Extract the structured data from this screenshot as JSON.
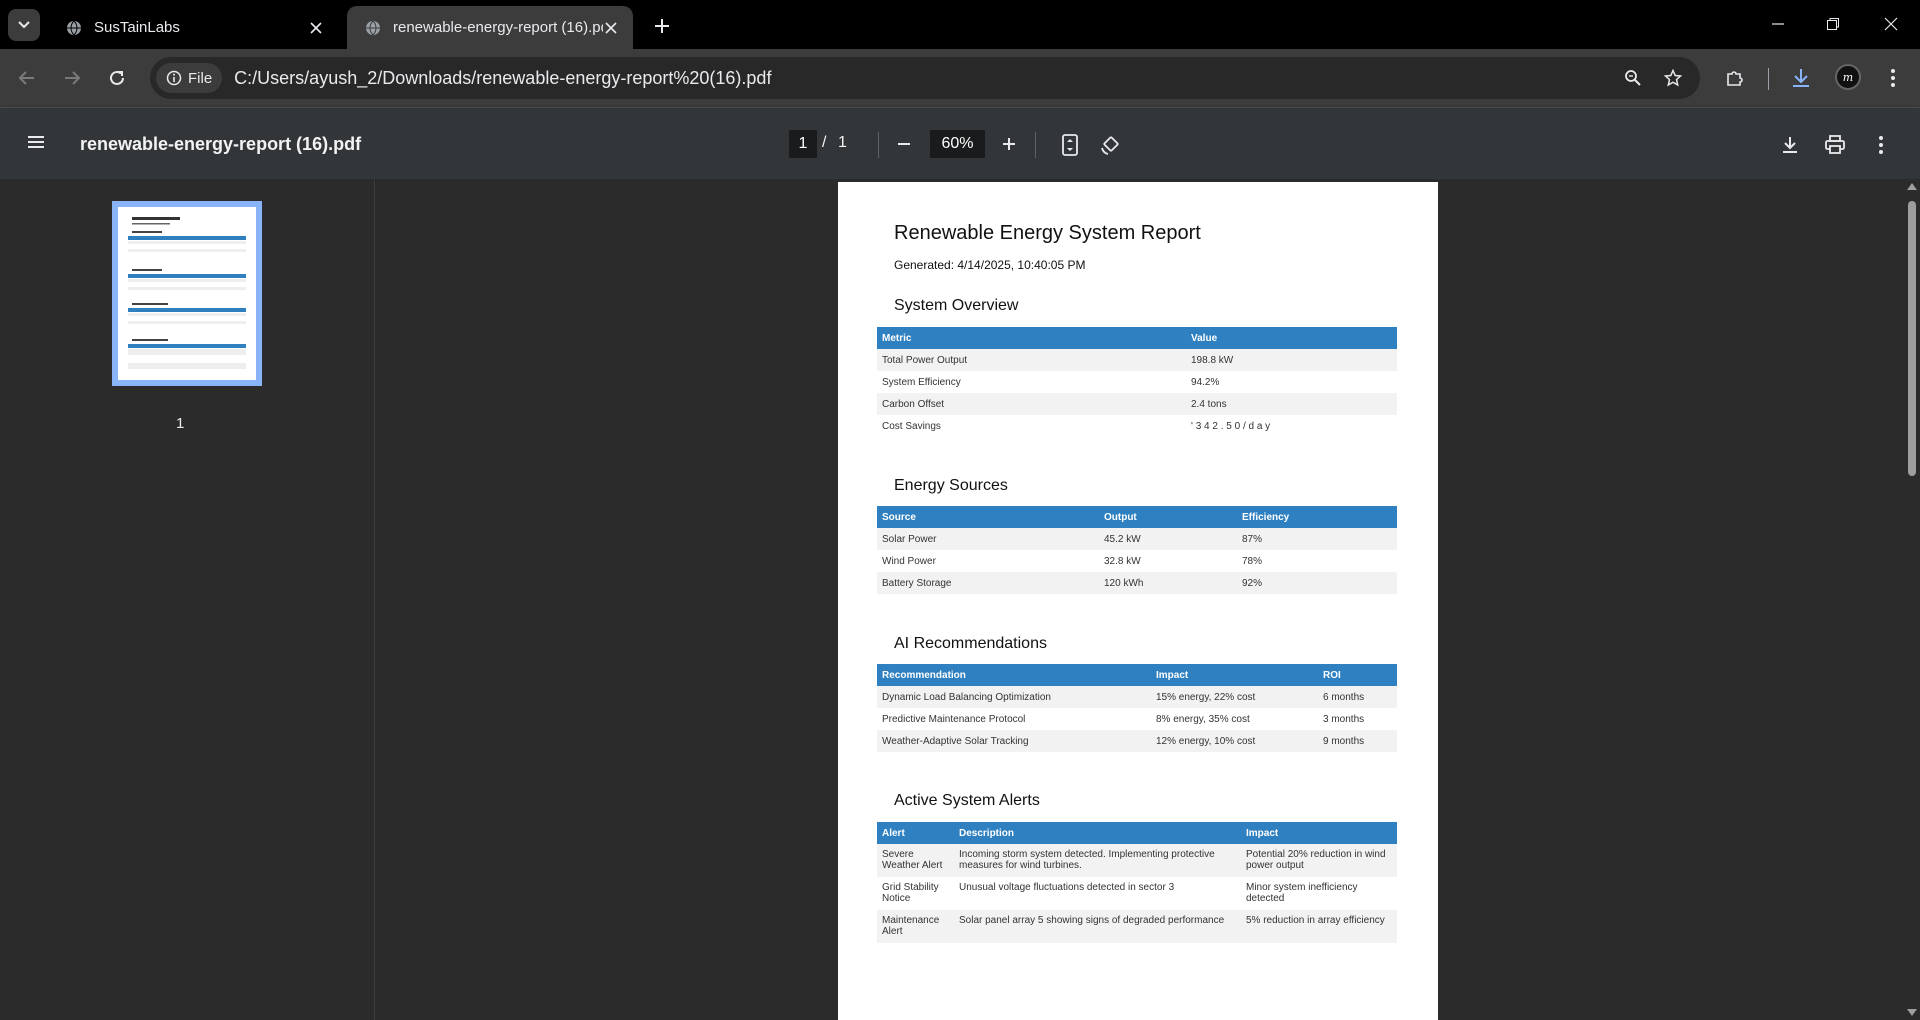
{
  "browser": {
    "tabs": [
      {
        "title": "SusTainLabs",
        "favicon": "globe-icon"
      },
      {
        "title": "renewable-energy-report (16).pdf",
        "favicon": "globe-icon"
      }
    ],
    "chip_label": "File",
    "url": "C:/Users/ayush_2/Downloads/renewable-energy-report%20(16).pdf",
    "profile_initial": "m"
  },
  "pdf_toolbar": {
    "file_name": "renewable-energy-report (16).pdf",
    "current_page": "1",
    "page_separator": "/",
    "total_pages": "1",
    "zoom": "60%"
  },
  "sidebar": {
    "thumbnail_label": "1"
  },
  "report": {
    "title": "Renewable Energy System Report",
    "generated": "Generated: 4/14/2025, 10:40:05 PM",
    "system_overview": {
      "heading": "System Overview",
      "headers": [
        "Metric",
        "Value"
      ],
      "rows": [
        [
          "Total Power Output",
          "198.8 kW"
        ],
        [
          "System Efficiency",
          "94.2%"
        ],
        [
          "Carbon Offset",
          "2.4 tons"
        ],
        [
          "Cost Savings",
          "' 3 4 2 . 5 0 / d a y"
        ]
      ]
    },
    "energy_sources": {
      "heading": "Energy Sources",
      "headers": [
        "Source",
        "Output",
        "Efficiency"
      ],
      "rows": [
        [
          "Solar Power",
          "45.2 kW",
          "87%"
        ],
        [
          "Wind Power",
          "32.8 kW",
          "78%"
        ],
        [
          "Battery Storage",
          "120 kWh",
          "92%"
        ]
      ]
    },
    "ai_recommendations": {
      "heading": "AI Recommendations",
      "headers": [
        "Recommendation",
        "Impact",
        "ROI"
      ],
      "rows": [
        [
          "Dynamic Load Balancing Optimization",
          "15% energy, 22% cost",
          "6 months"
        ],
        [
          "Predictive Maintenance Protocol",
          "8% energy, 35% cost",
          "3 months"
        ],
        [
          "Weather-Adaptive Solar Tracking",
          "12% energy, 10% cost",
          "9 months"
        ]
      ]
    },
    "active_alerts": {
      "heading": "Active System Alerts",
      "headers": [
        "Alert",
        "Description",
        "Impact"
      ],
      "rows": [
        [
          "Severe Weather Alert",
          "Incoming storm system detected. Implementing protective measures for wind turbines.",
          "Potential 20% reduction in wind power output"
        ],
        [
          "Grid Stability Notice",
          "Unusual voltage fluctuations detected in sector 3",
          "Minor system inefficiency detected"
        ],
        [
          "Maintenance Alert",
          "Solar panel array 5 showing signs of degraded performance",
          "5% reduction in array efficiency"
        ]
      ]
    }
  },
  "colors": {
    "table_header": "#2f80c0",
    "accent_download": "#8ab4f8"
  }
}
